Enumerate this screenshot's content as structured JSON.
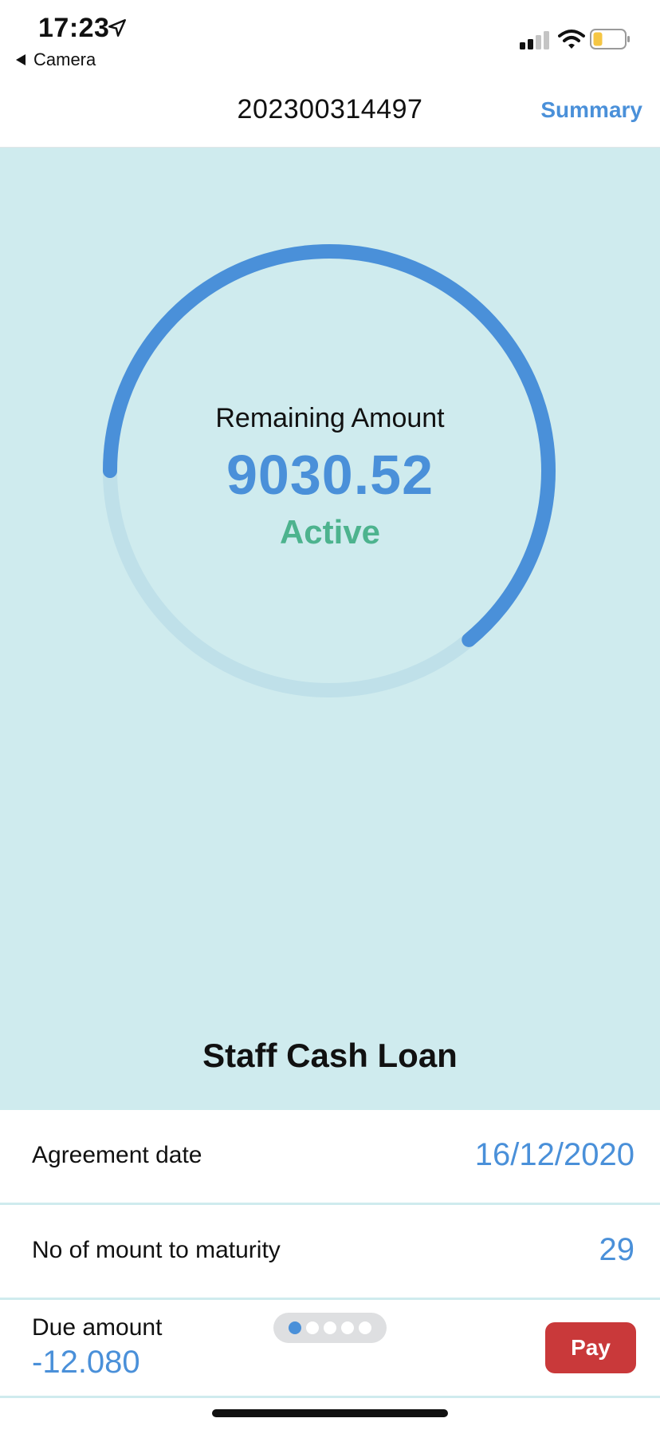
{
  "status_bar": {
    "time": "17:23",
    "back_app": "Camera",
    "icons": [
      "location-arrow-icon",
      "signal-icon",
      "wifi-icon",
      "battery-icon"
    ]
  },
  "nav": {
    "title": "202300314497",
    "summary_label": "Summary"
  },
  "loan": {
    "ring_label": "Remaining Amount",
    "remaining_amount": "9030.52",
    "status": "Active",
    "progress_fraction": 0.64,
    "name": "Staff Cash Loan"
  },
  "details": {
    "agreement_label": "Agreement date",
    "agreement_value": "16/12/2020",
    "maturity_label": "No of mount to maturity",
    "maturity_value": "29",
    "due_label": "Due amount",
    "due_value": "-12.080",
    "pay_label": "Pay"
  },
  "pager": {
    "count": 5,
    "active_index": 0
  },
  "colors": {
    "accent": "#4a90d9",
    "status_active": "#4db38e",
    "hero_bg": "#cfebee",
    "ring_track": "#bfe0e9",
    "pay_button": "#c9393a"
  }
}
